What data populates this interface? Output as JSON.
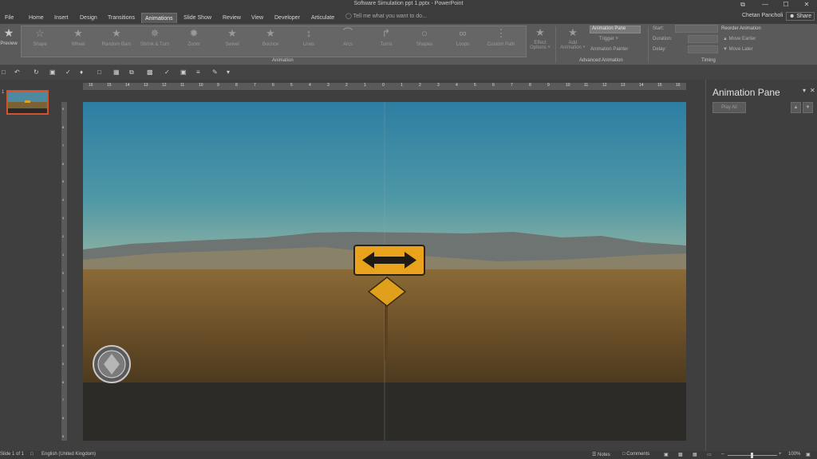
{
  "window": {
    "title": "Software Simulation ppt 1.pptx - PowerPoint",
    "user": "Chetan Pancholi",
    "share": "Share",
    "buttons": [
      "⧉",
      "—",
      "☐",
      "✕"
    ]
  },
  "tabs": [
    "File",
    "Home",
    "Insert",
    "Design",
    "Transitions",
    "Animations",
    "Slide Show",
    "Review",
    "View",
    "Developer",
    "Articulate"
  ],
  "active_tab": "Animations",
  "tell_me": "Tell me what you want to do...",
  "ribbon": {
    "preview": "Preview",
    "animations": [
      {
        "label": "Shape",
        "icon": "star-icon"
      },
      {
        "label": "Wheel",
        "icon": "star-icon"
      },
      {
        "label": "Random Bars",
        "icon": "star-icon"
      },
      {
        "label": "Shrink & Turn",
        "icon": "star-icon"
      },
      {
        "label": "Zoom",
        "icon": "star-icon"
      },
      {
        "label": "Swivel",
        "icon": "star-icon"
      },
      {
        "label": "Bounce",
        "icon": "star-icon"
      },
      {
        "label": "Lines",
        "icon": "line-path-icon"
      },
      {
        "label": "Arcs",
        "icon": "arc-path-icon"
      },
      {
        "label": "Turns",
        "icon": "turn-path-icon"
      },
      {
        "label": "Shapes",
        "icon": "circle-path-icon"
      },
      {
        "label": "Loops",
        "icon": "loop-path-icon"
      },
      {
        "label": "Custom Path",
        "icon": "custom-path-icon"
      }
    ],
    "effect_options": [
      "Effect",
      "Options ˅"
    ],
    "animation_group_label": "Animation",
    "add_animation": [
      "Add",
      "Animation ˅"
    ],
    "animation_pane": "Animation Pane",
    "trigger": "Trigger ˅",
    "animation_painter": "Animation Painter",
    "advanced_label": "Advanced Animation",
    "start_label": "Start:",
    "duration_label": "Duration:",
    "delay_label": "Delay:",
    "reorder_label": "Reorder Animation",
    "move_earlier": "▲ Move Earlier",
    "move_later": "▼ Move Later",
    "timing_label": "Timing"
  },
  "ruler_ticks": [
    "16",
    "15",
    "14",
    "13",
    "12",
    "11",
    "10",
    "9",
    "8",
    "7",
    "6",
    "5",
    "4",
    "3",
    "2",
    "1",
    "0",
    "1",
    "2",
    "3",
    "4",
    "5",
    "6",
    "7",
    "8",
    "9",
    "10",
    "11",
    "12",
    "13",
    "14",
    "15",
    "16"
  ],
  "vruler_ticks": [
    "9",
    "8",
    "7",
    "6",
    "5",
    "4",
    "3",
    "2",
    "1",
    "0",
    "1",
    "2",
    "3",
    "4",
    "5",
    "6",
    "7",
    "8",
    "9"
  ],
  "slides": {
    "current_number": "1"
  },
  "anim_pane": {
    "title": "Animation Pane",
    "play_all": "Play All",
    "up": "▲",
    "down": "▼",
    "close": "✕",
    "menu": "▾"
  },
  "status": {
    "slide": "Slide 1 of 1",
    "language": "English (United Kingdom)",
    "notes": "Notes",
    "comments": "Comments",
    "zoom": "100%"
  },
  "colors": {
    "accent": "#d35230",
    "ribbon_bg": "#5a5a5a"
  }
}
